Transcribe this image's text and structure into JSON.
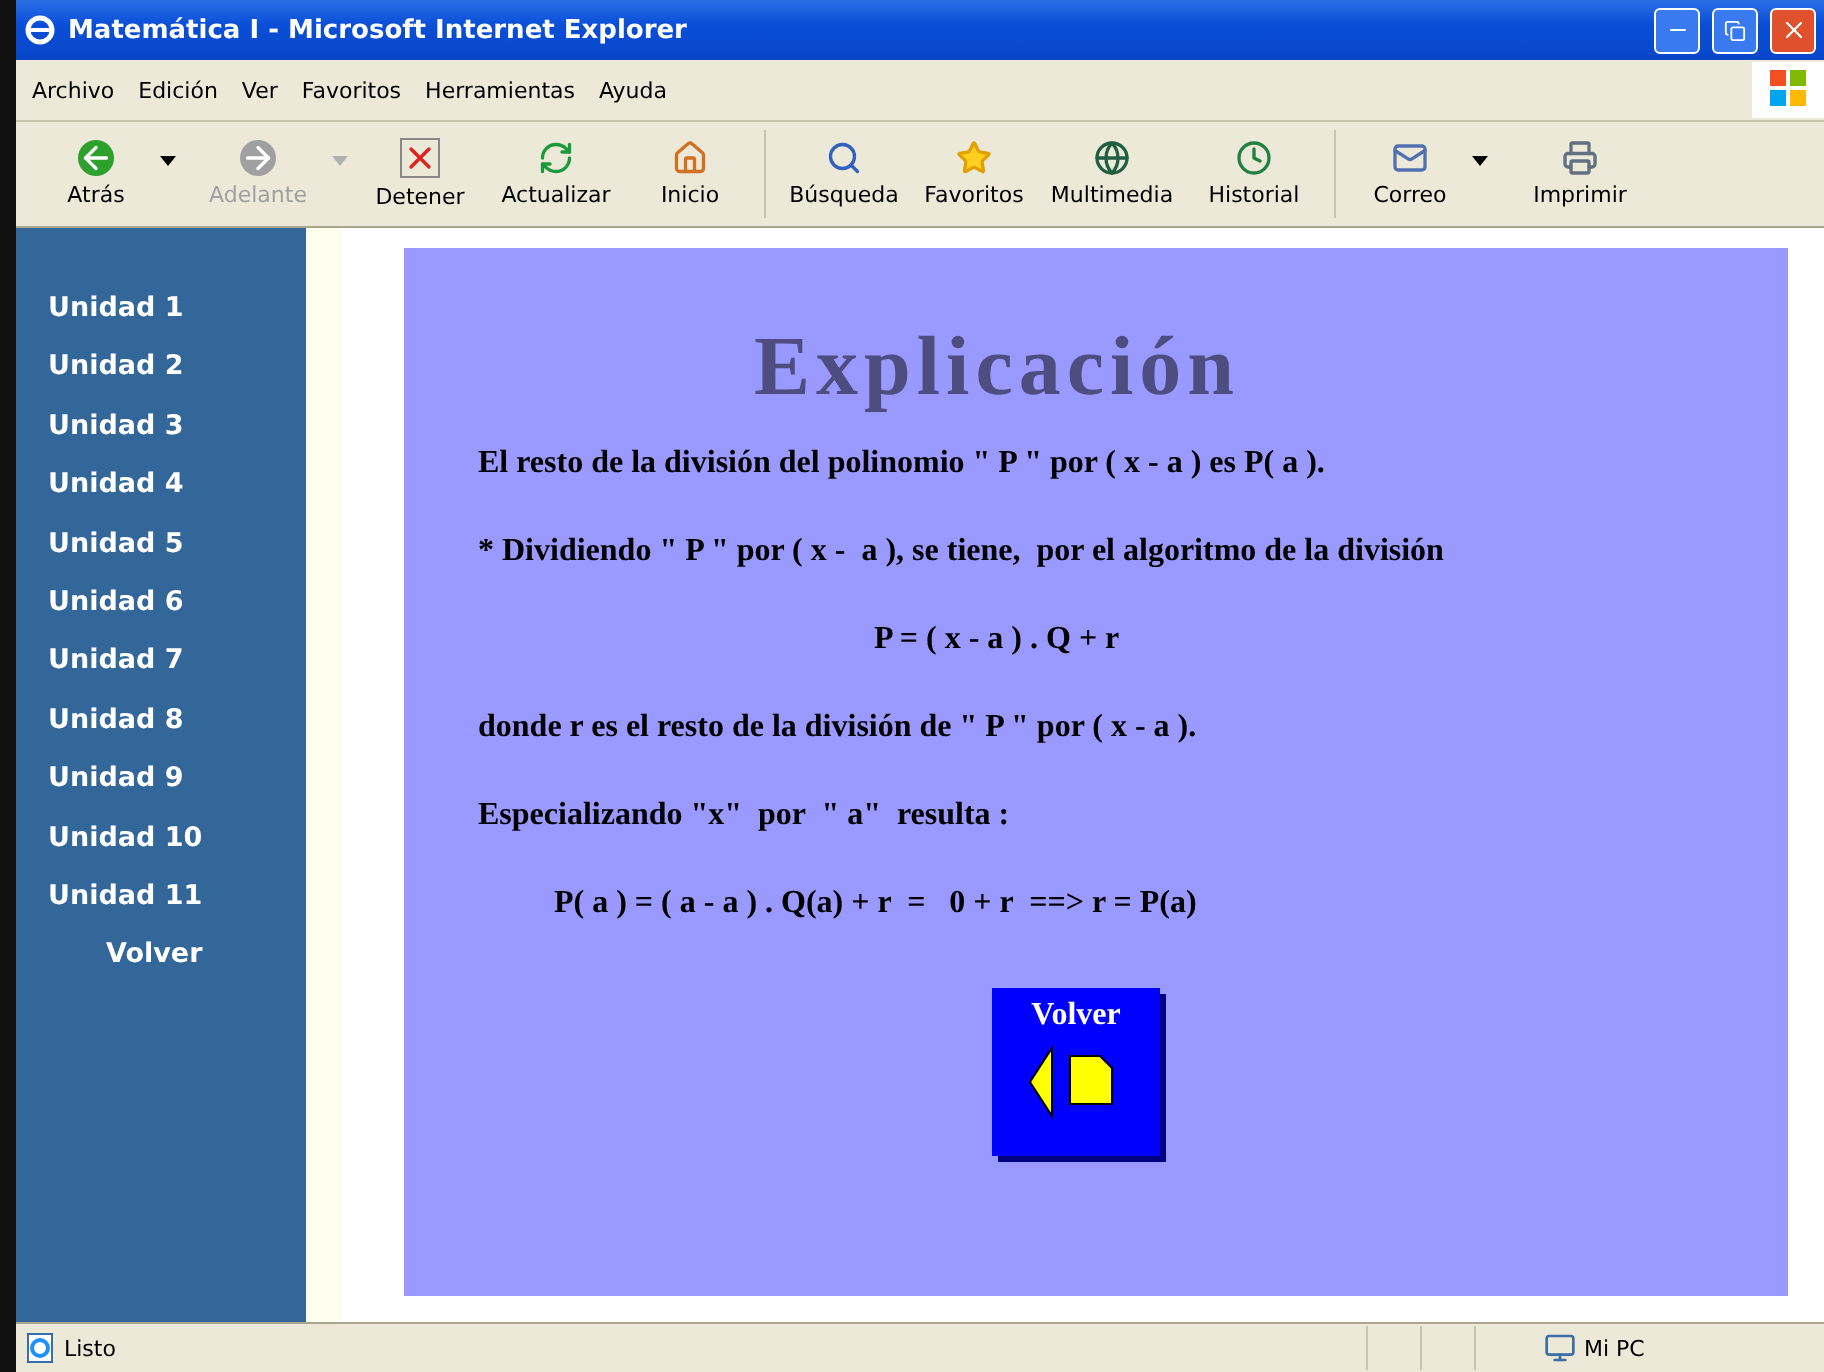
{
  "window": {
    "title": "Matemática I - Microsoft Internet Explorer"
  },
  "menu": [
    "Archivo",
    "Edición",
    "Ver",
    "Favoritos",
    "Herramientas",
    "Ayuda"
  ],
  "toolbar": [
    {
      "kind": "back",
      "label": "Atrás",
      "disabled": false,
      "has_menu": true
    },
    {
      "kind": "forward",
      "label": "Adelante",
      "disabled": true,
      "has_menu": true
    },
    {
      "kind": "stop",
      "label": "Detener",
      "disabled": false,
      "has_menu": false
    },
    {
      "kind": "refresh",
      "label": "Actualizar",
      "disabled": false,
      "has_menu": false
    },
    {
      "kind": "home",
      "label": "Inicio",
      "disabled": false,
      "has_menu": false
    },
    {
      "kind": "search",
      "label": "Búsqueda",
      "disabled": false,
      "has_menu": false
    },
    {
      "kind": "favorites",
      "label": "Favoritos",
      "disabled": false,
      "has_menu": false
    },
    {
      "kind": "media",
      "label": "Multimedia",
      "disabled": false,
      "has_menu": false
    },
    {
      "kind": "history",
      "label": "Historial",
      "disabled": false,
      "has_menu": false
    },
    {
      "kind": "mail",
      "label": "Correo",
      "disabled": false,
      "has_menu": true
    },
    {
      "kind": "print",
      "label": "Imprimir",
      "disabled": false,
      "has_menu": false
    }
  ],
  "sidebar": {
    "items": [
      "Unidad 1",
      "Unidad 2",
      "Unidad 3",
      "Unidad 4",
      "Unidad 5",
      "Unidad 6",
      "Unidad 7",
      "Unidad 8",
      "Unidad 9",
      "Unidad 10",
      "Unidad 11"
    ],
    "back_link": "Volver"
  },
  "content": {
    "heading": "Explicación",
    "paragraphs": [
      {
        "kind": "text",
        "text": "El resto de la división del polinomio \" P \" por ( x - a ) es P( a )."
      },
      {
        "kind": "text",
        "text": "* Dividiendo \" P \" por ( x -  a ), se tiene,  por el algoritmo de la división"
      },
      {
        "kind": "centered",
        "text": "P = ( x - a ) . Q + r"
      },
      {
        "kind": "text",
        "text": "donde r es el resto de la división de \" P \" por ( x - a )."
      },
      {
        "kind": "text",
        "text": "Especializando \"x\"  por  \" a\"  resulta :"
      },
      {
        "kind": "indented",
        "text": "P( a ) = ( a - a ) . Q(a) + r  =   0 + r  ==> r = P(a)"
      }
    ],
    "back_button": "Volver"
  },
  "status_bar": {
    "status": "Listo",
    "zone": "Mi PC"
  }
}
